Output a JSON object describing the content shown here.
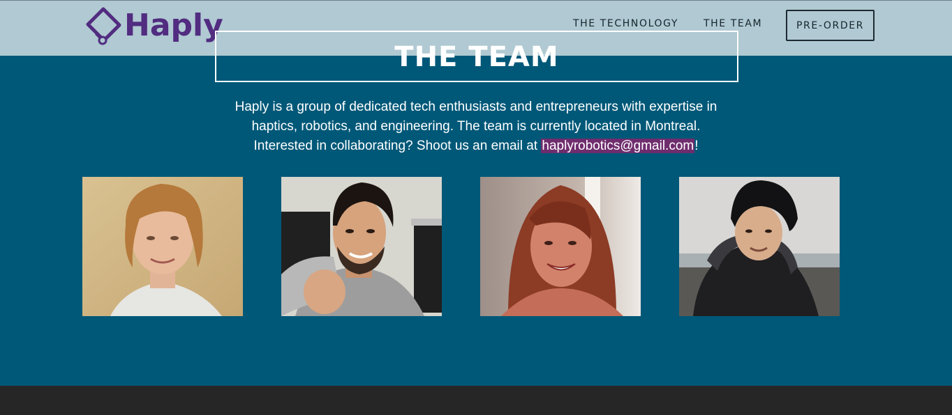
{
  "brand": {
    "name": "Haply",
    "color": "#512c80",
    "icon": "diamond-pin-logo-icon"
  },
  "nav": {
    "items": [
      {
        "label": "THE TECHNOLOGY"
      },
      {
        "label": "THE TEAM"
      }
    ],
    "cta_label": "PRE-ORDER"
  },
  "section": {
    "title": "THE TEAM",
    "intro_line1": "Haply is a group of dedicated tech enthusiasts and entrepreneurs with expertise in",
    "intro_line2": "haptics, robotics, and engineering. The team is currently located in Montreal.",
    "intro_line3_prefix": "Interested in collaborating? Shoot us an email at ",
    "email": "haplyrobotics@gmail.com",
    "intro_line3_suffix": "!"
  },
  "team_photos": [
    {
      "kind": "portrait"
    },
    {
      "kind": "portrait"
    },
    {
      "kind": "portrait"
    },
    {
      "kind": "portrait"
    }
  ],
  "colors": {
    "navbar_bg": "#b0c9d2",
    "section_bg": "#005878",
    "email_highlight": "#6f2d6e",
    "footer_bg": "#262626"
  }
}
